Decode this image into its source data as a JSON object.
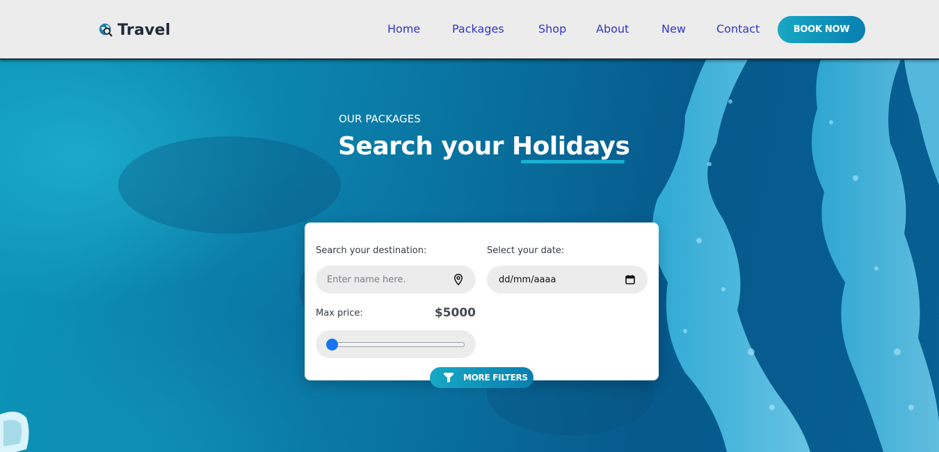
{
  "header": {
    "logo_text": "Travel",
    "logo_icon": "globe-search-icon",
    "nav": [
      {
        "label": "Home"
      },
      {
        "label": "Packages"
      },
      {
        "label": "Shop"
      },
      {
        "label": "About"
      },
      {
        "label": "New"
      },
      {
        "label": "Contact"
      }
    ],
    "cta_label": "BOOK NOW"
  },
  "hero": {
    "eyebrow": "OUR PACKAGES",
    "title": "Search your Holidays"
  },
  "search": {
    "destination_label": "Search your destination:",
    "destination_placeholder": "Enter name here.",
    "destination_icon": "map-pin-icon",
    "date_label": "Select your date:",
    "date_value": "dd/mm/aaaa",
    "date_icon": "calendar-icon",
    "price_label": "Max price:",
    "price_value": "$5000",
    "slider_level": 0,
    "filters_label": "MORE FILTERS",
    "filters_icon": "funnel-icon"
  },
  "colors": {
    "accent": "#17b1d4",
    "nav_link": "#2d35c6",
    "header_bg": "#ececec",
    "slider_thumb": "#1773f0"
  }
}
